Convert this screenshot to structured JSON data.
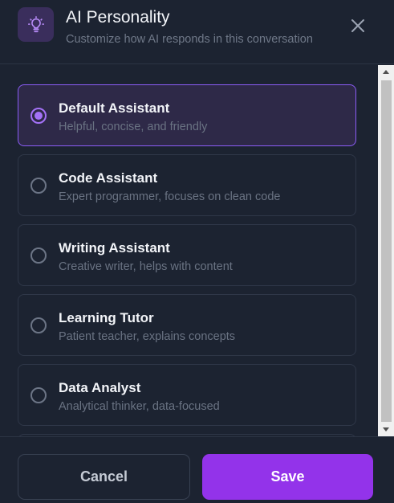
{
  "header": {
    "icon": "lightbulb-icon",
    "title": "AI Personality",
    "subtitle": "Customize how AI responds in this conversation",
    "close_icon": "close-icon"
  },
  "options": [
    {
      "name": "Default Assistant",
      "description": "Helpful, concise, and friendly",
      "selected": true
    },
    {
      "name": "Code Assistant",
      "description": "Expert programmer, focuses on clean code",
      "selected": false
    },
    {
      "name": "Writing Assistant",
      "description": "Creative writer, helps with content",
      "selected": false
    },
    {
      "name": "Learning Tutor",
      "description": "Patient teacher, explains concepts",
      "selected": false
    },
    {
      "name": "Data Analyst",
      "description": "Analytical thinker, data-focused",
      "selected": false
    }
  ],
  "footer": {
    "cancel_label": "Cancel",
    "save_label": "Save"
  },
  "colors": {
    "accent": "#9333ea",
    "selected_border": "#8b5cf6",
    "background": "#1c2331"
  }
}
